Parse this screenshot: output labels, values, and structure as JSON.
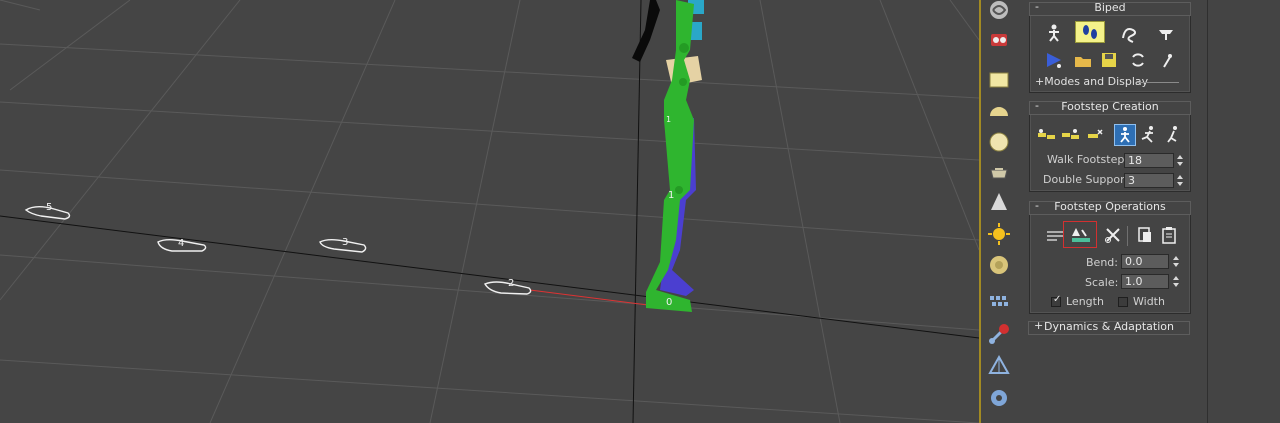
{
  "viewport": {
    "footstep_labels": [
      "5",
      "4",
      "3",
      "2",
      "1",
      "0"
    ],
    "bone_label": "1"
  },
  "create_panel": {
    "rail_icons": [
      "spacewarps-icon",
      "systems-icon",
      "plane-icon",
      "hemisphere-icon",
      "sphere-icon",
      "teapot-icon",
      "cone-icon",
      "sun-icon",
      "torus-icon",
      "grid-icon",
      "bones-icon",
      "pyramid-icon",
      "gear-icon"
    ]
  },
  "biped": {
    "title": "Biped",
    "collapse_symbol": "-",
    "modes_label": "+Modes and Display",
    "tools_row1": [
      "figure-mode",
      "footstep-mode",
      "motion-flow-mode",
      "mixer-mode"
    ],
    "tools_row2": [
      "biped-playback",
      "load-file",
      "save-file",
      "convert",
      "move-all-mode"
    ]
  },
  "footstep_creation": {
    "title": "Footstep Creation",
    "collapse_symbol": "-",
    "walk_footstep_label": "Walk Footstep",
    "walk_footstep_value": "18",
    "double_support_label": "Double Support",
    "double_support_value": "3",
    "gaits": [
      "walk",
      "run",
      "jump"
    ]
  },
  "footstep_operations": {
    "title": "Footstep Operations",
    "collapse_symbol": "-",
    "bend_label": "Bend:",
    "bend_value": "0.0",
    "scale_label": "Scale:",
    "scale_value": "1.0",
    "length_label": "Length",
    "length_checked": true,
    "width_label": "Width",
    "width_checked": false
  },
  "dynamics": {
    "title": "Dynamics & Adaptation",
    "collapse_symbol": "+"
  },
  "colors": {
    "viewport_bg": "#454545",
    "grid": "#5a5a5a",
    "accent_yellow": "#f4f28a",
    "accent_blue": "#2e6fb4",
    "selection_red": "#d23030",
    "biped_green": "#2fb52f",
    "biped_blue": "#4b3fd0",
    "rail_border": "#a28a22"
  }
}
